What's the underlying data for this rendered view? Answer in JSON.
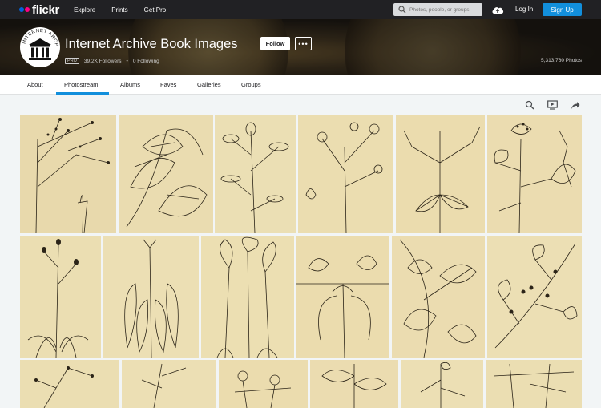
{
  "nav": {
    "logo_text": "flickr",
    "links": [
      "Explore",
      "Prints",
      "Get Pro"
    ],
    "search_placeholder": "Photos, people, or groups",
    "login": "Log In",
    "signup": "Sign Up"
  },
  "profile": {
    "title": "Internet Archive Book Images",
    "follow_label": "Follow",
    "more_label": "•••",
    "pro_badge": "PRO",
    "followers": "39.2K Followers",
    "following": "0 Following",
    "photos": "5,313,760 Photos",
    "avatar_text": "INTERNET ARCHIVE"
  },
  "tabs": [
    "About",
    "Photostream",
    "Albums",
    "Faves",
    "Galleries",
    "Groups"
  ],
  "active_tab": "Photostream",
  "toolbar": {
    "icons": [
      "search-icon",
      "slideshow-icon",
      "share-icon"
    ]
  },
  "photostream": {
    "tile_count": 18,
    "tile_color": "#e9dcb0",
    "ink_color": "#2b2418"
  },
  "colors": {
    "brand_blue": "#0063dc",
    "brand_pink": "#ff0084",
    "signup_blue": "#128fdc",
    "nav_bg": "#212124"
  }
}
